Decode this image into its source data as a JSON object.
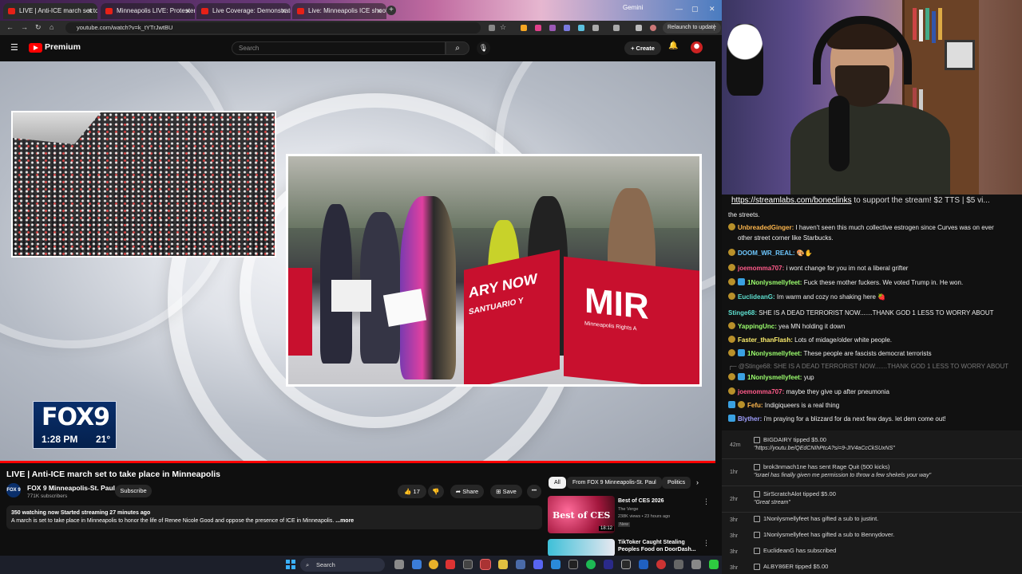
{
  "browser": {
    "tabs": [
      {
        "title": "LIVE | Anti-ICE march set to"
      },
      {
        "title": "Minneapolis LIVE: Protesters G"
      },
      {
        "title": "Live Coverage: Demonstrators"
      },
      {
        "title": "Live: Minneapolis ICE shootin"
      }
    ],
    "extra_tab": "Gemini",
    "url": "youtube.com/watch?v=k_tYTrJwtBU",
    "relaunch": "Relaunch to update"
  },
  "youtube": {
    "brand": "Premium",
    "search_placeholder": "Search",
    "create_label": "Create",
    "video": {
      "fox_logo": "FOX9",
      "fox_time": "1:28 PM",
      "fox_temp": "21°",
      "banner_left": "ARY NOW",
      "banner_left2": "SANTUARIO Y",
      "banner_right": "MIR",
      "banner_right_sub": "Minneapolis Rights A"
    },
    "title": "LIVE | Anti-ICE march set to take place in Minneapolis",
    "channel": {
      "avatar_text": "FOX 9",
      "name": "FOX 9 Minneapolis-St. Paul",
      "subs": "771K subscribers",
      "subscribe": "Subscribe"
    },
    "actions": {
      "likes": "17",
      "share": "Share",
      "save": "Save",
      "more": "•••"
    },
    "description": {
      "stats": "350 watching now  Started streaming 27 minutes ago",
      "text": "A march is set to take place in Minneapolis to honor the life of Renee Nicole Good and oppose the presence of ICE in Minneapolis.",
      "more": "...more"
    },
    "chips": [
      "All",
      "From FOX 9 Minneapolis-St. Paul",
      "Politics"
    ],
    "recommendations": [
      {
        "thumb_text": "Best of CES",
        "duration": "18:12",
        "title": "Best of CES 2026",
        "channel": "The Verge",
        "meta": "238K views • 23 hours ago",
        "badge": "New"
      },
      {
        "title1": "TikToker Caught Stealing",
        "title2": "Peoples Food on DoorDash..."
      }
    ]
  },
  "stream": {
    "link_text": "https://streamlabs.com/boneclinks",
    "link_suffix": " to support the stream! $2 TTS | $5 vi..."
  },
  "chat": [
    {
      "user": "",
      "text": "the streets."
    },
    {
      "user": "UnbreadedGinger:",
      "text": " I haven't seen this much collective estrogen since Curves was on ever"
    },
    {
      "user": "",
      "text": "other street corner like Starbucks."
    },
    {
      "user": "DOOM_WR_REAL:",
      "text": ""
    },
    {
      "user": "joemomma707:",
      "text": " i wont change for you im not a liberal grifter"
    },
    {
      "user": "1Nonlysmellyfeet:",
      "text": " Fuck these mother fuckers. We voted Trump in. He won."
    },
    {
      "user": "EuclideanG:",
      "text": " Im warm and cozy no shaking here"
    },
    {
      "user": "Stinge68:",
      "text": " SHE IS A DEAD TERRORIST NOW.......THANK GOD 1 LESS TO WORRY ABOUT"
    },
    {
      "user": "YappingUnc:",
      "text": " yea MN holding it down"
    },
    {
      "user": "Faster_thanFlash:",
      "text": " Lots of midage/older white people."
    },
    {
      "user": "1Nonlysmellyfeet:",
      "text": " These people are fascists democrat terrorists"
    },
    {
      "user": "",
      "text": "@Stinge68: SHE IS A DEAD TERRORIST NOW.......THANK GOD 1 LESS TO WORRY ABOUT"
    },
    {
      "user": "1Nonlysmellyfeet:",
      "text": " yup"
    },
    {
      "user": "joemomma707:",
      "text": " maybe they give up after pneumonia"
    },
    {
      "user": "Fefu:",
      "text": " Indigiqueers is a real thing"
    },
    {
      "user": "Blyther:",
      "text": " i'm praying for a blizzard for da next few days. let dem come out!"
    }
  ],
  "events": [
    {
      "time": "42m",
      "line1": "BIGDAIRY tipped $5.00",
      "line2": "\"https://youtu.be/QEdCNIhPtcA?si=9-JIV4aCcCkSUxNS\""
    },
    {
      "time": "1hr",
      "line1": "brok3nmach1ne has sent Rage Quit (500 kicks)",
      "line2": "\"israel has finally given me permission to throw a few shekels your way\""
    },
    {
      "time": "2hr",
      "line1": "SirScratchAlot tipped $5.00",
      "line2": "\"Great stream\""
    },
    {
      "time": "3hr",
      "line1": "1Nonlysmellyfeet has gifted a sub to justint."
    },
    {
      "time": "3hr",
      "line1": "1Nonlysmellyfeet has gifted a sub to Bennydover."
    },
    {
      "time": "3hr",
      "line1": "EuclideanG has subscribed"
    },
    {
      "time": "3hr",
      "line1": "ALBY86ER tipped $5.00"
    }
  ],
  "taskbar": {
    "search": "Search"
  }
}
